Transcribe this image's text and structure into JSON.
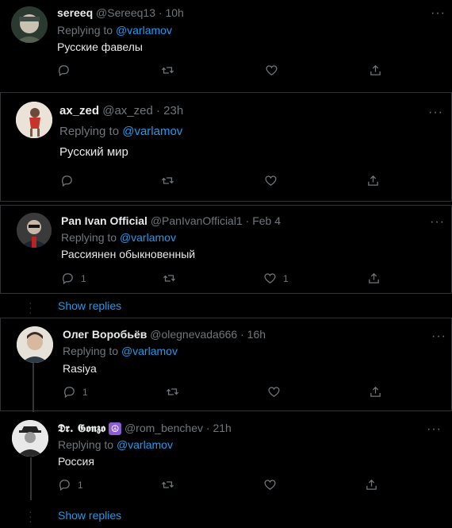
{
  "labels": {
    "replying_to": "Replying to"
  },
  "tweets": [
    {
      "name": "sereeq",
      "handle": "@Sereeq13",
      "time": "10h",
      "mention": "@varlamov",
      "text": "Русские фавелы",
      "reply_count": "",
      "like_count": ""
    },
    {
      "name": "ax_zed",
      "handle": "@ax_zed",
      "time": "23h",
      "mention": "@varlamov",
      "text": "Русский мир",
      "reply_count": "",
      "like_count": ""
    },
    {
      "name": "Pan Ivan Official",
      "handle": "@PanIvanOfficial1",
      "time": "Feb 4",
      "mention": "@varlamov",
      "text": "Рассиянен обыкновенный",
      "reply_count": "1",
      "like_count": "1"
    },
    {
      "name": "Олег Воробьёв",
      "handle": "@olegnevada666",
      "time": "16h",
      "mention": "@varlamov",
      "text": "Rasiya",
      "reply_count": "1",
      "like_count": ""
    },
    {
      "name": "𝕯𝖗. 𝕲𝖔𝖓𝖟𝖔",
      "emoji": "☮",
      "handle": "@rom_benchev",
      "time": "21h",
      "mention": "@varlamov",
      "text": "Россия",
      "reply_count": "1",
      "like_count": ""
    }
  ],
  "show_replies": [
    "Show replies",
    "Show replies"
  ],
  "colors": {
    "accent": "#1d9bf0",
    "muted": "#71767b",
    "text": "#e7e9ea",
    "background": "#000000"
  }
}
